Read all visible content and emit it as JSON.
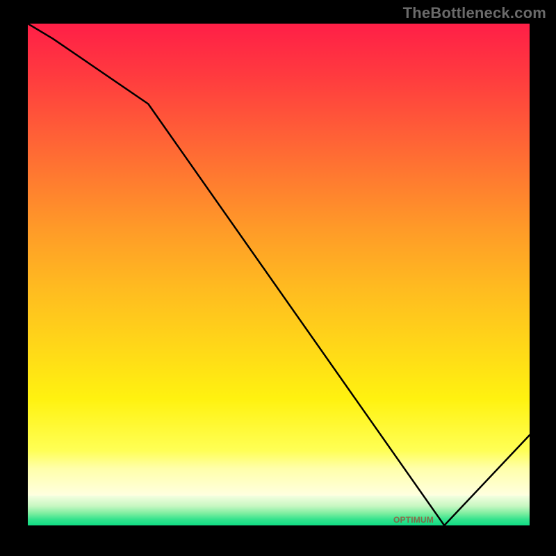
{
  "watermark": "TheBottleneck.com",
  "chart_data": {
    "type": "line",
    "title": "",
    "xlabel": "",
    "ylabel": "",
    "xlim": [
      0,
      100
    ],
    "ylim": [
      0,
      100
    ],
    "x": [
      0,
      5,
      24,
      83,
      100
    ],
    "y": [
      100,
      97,
      84,
      0,
      18
    ],
    "optimal_range_x": [
      68,
      86
    ],
    "optimal_label": "OPTIMUM"
  },
  "colors": {
    "top": "#ff1f47",
    "middle": "#ffd818",
    "bottom_green": "#10dd85",
    "curve": "#000000",
    "watermark": "#6a6a6a"
  }
}
